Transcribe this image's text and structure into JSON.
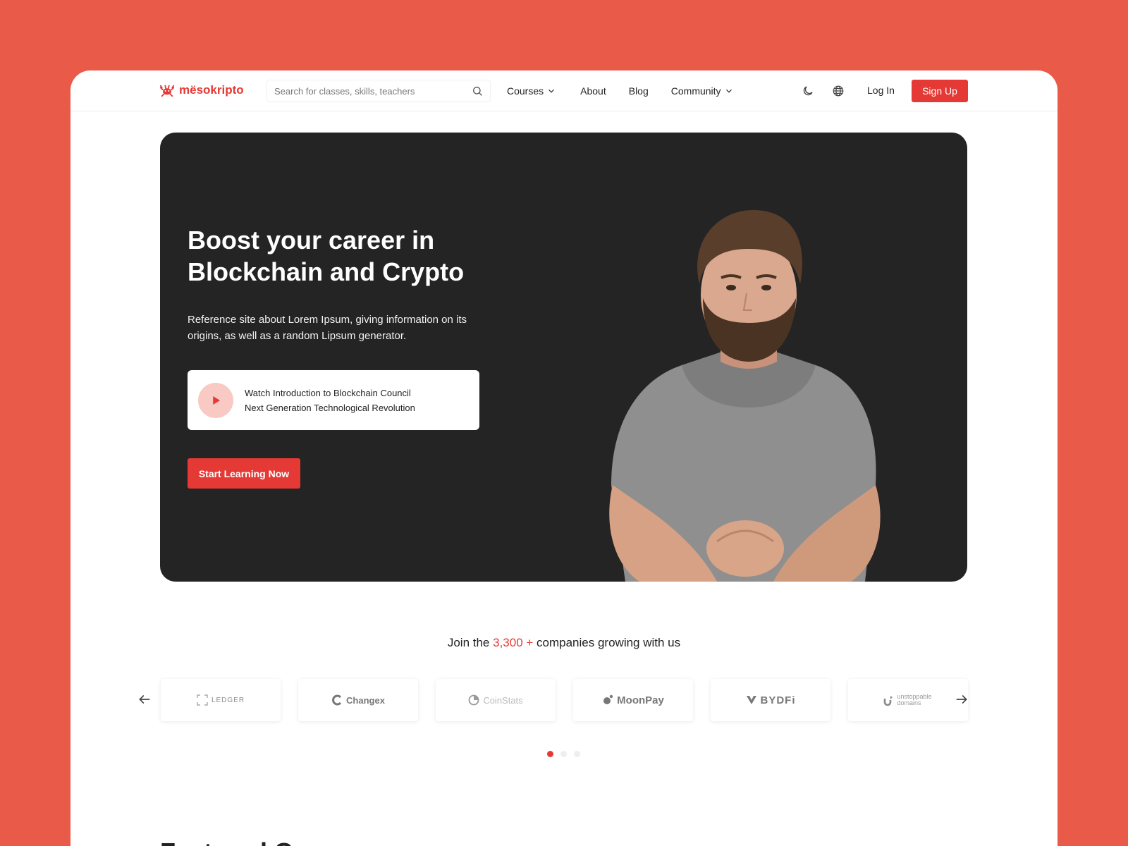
{
  "brand": {
    "name": "mësokripto",
    "logo_icon": "crab-icon",
    "accent_color": "#E53935"
  },
  "search": {
    "placeholder": "Search for classes, skills, teachers"
  },
  "nav": {
    "items": [
      {
        "label": "Courses",
        "has_dropdown": true
      },
      {
        "label": "About",
        "has_dropdown": false
      },
      {
        "label": "Blog",
        "has_dropdown": false
      },
      {
        "label": "Community",
        "has_dropdown": true
      }
    ],
    "login_label": "Log In",
    "signup_label": "Sign Up"
  },
  "hero": {
    "title": "Boost your career in Blockchain and Crypto",
    "description": "Reference site about Lorem Ipsum, giving information on its origins, as well as a random Lipsum generator.",
    "video": {
      "line1": "Watch Introduction to Blockchain Council",
      "line2": "Next Generation Technological Revolution"
    },
    "cta_label": "Start Learning Now",
    "background_color": "#242424"
  },
  "companies": {
    "prefix": "Join the ",
    "count": "3,300 +",
    "suffix": " companies growing with us",
    "logos": [
      {
        "name": "LEDGER",
        "icon": "ledger-icon"
      },
      {
        "name": "Changex",
        "icon": "changex-icon"
      },
      {
        "name": "CoinStats",
        "icon": "coinstats-icon"
      },
      {
        "name": "MoonPay",
        "icon": "moonpay-icon"
      },
      {
        "name": "BYDFi",
        "icon": "bydfi-icon"
      },
      {
        "name": "unstoppable domains",
        "icon": "unstoppable-icon"
      }
    ],
    "pagination": {
      "pages": 3,
      "active": 1
    }
  },
  "next_section": {
    "title": "Featured Courses"
  }
}
